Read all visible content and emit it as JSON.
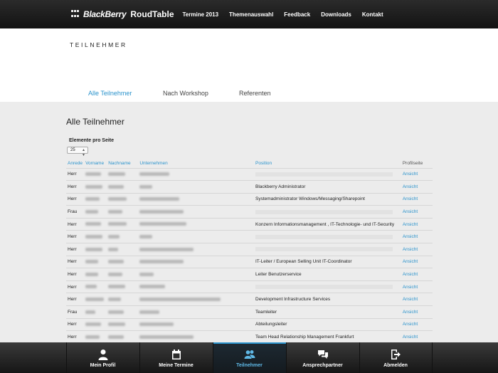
{
  "brand": {
    "name": "BlackBerry",
    "sub": "RoudTable"
  },
  "nav": [
    "Termine 2013",
    "Themenauswahl",
    "Feedback",
    "Downloads",
    "Kontakt"
  ],
  "page_title": "TEILNEHMER",
  "tabs": [
    {
      "label": "Alle Teilnehmer",
      "active": true
    },
    {
      "label": "Nach Workshop",
      "active": false
    },
    {
      "label": "Referenten",
      "active": false
    }
  ],
  "section_title": "Alle Teilnehmer",
  "per_page": {
    "label": "Elemente pro Seite",
    "value": "25"
  },
  "table": {
    "headers": [
      "Anrede",
      "Vorname",
      "Nachname",
      "Unternehmen",
      "Position",
      "Profilseite"
    ],
    "rows": [
      {
        "anrede": "Herr",
        "position": "",
        "link": "Ansicht"
      },
      {
        "anrede": "Herr",
        "position": "Blackberry Administrator",
        "link": "Ansicht"
      },
      {
        "anrede": "Herr",
        "position": "Systemadministrator Windows/Messaging/Sharepoint",
        "link": "Ansicht"
      },
      {
        "anrede": "Frau",
        "position": "",
        "link": "Ansicht"
      },
      {
        "anrede": "Herr",
        "position": "Konzern Informationsmanagement , IT-Technologie- und IT-Security",
        "link": "Ansicht"
      },
      {
        "anrede": "Herr",
        "position": "",
        "link": "Ansicht"
      },
      {
        "anrede": "Herr",
        "position": "",
        "link": "Ansicht"
      },
      {
        "anrede": "Herr",
        "position": "IT-Leiter / European Selling Unit IT-Coordinator",
        "link": "Ansicht"
      },
      {
        "anrede": "Herr",
        "position": "Leiter Benutzerservice",
        "link": "Ansicht"
      },
      {
        "anrede": "Herr",
        "position": "",
        "link": "Ansicht"
      },
      {
        "anrede": "Herr",
        "position": "Development Infrastructure Services",
        "link": "Ansicht"
      },
      {
        "anrede": "Frau",
        "position": "Teamleiter",
        "link": "Ansicht"
      },
      {
        "anrede": "Herr",
        "position": "Abteilungsleiter",
        "link": "Ansicht"
      },
      {
        "anrede": "Herr",
        "position": "Team Head Relationship Management Frankfurt",
        "link": "Ansicht"
      }
    ]
  },
  "bottom_nav": [
    {
      "label": "Mein Profil",
      "icon": "person-icon",
      "active": false
    },
    {
      "label": "Meine Termine",
      "icon": "calendar-icon",
      "active": false
    },
    {
      "label": "Teilnehmer",
      "icon": "people-icon",
      "active": true
    },
    {
      "label": "Ansprechpartner",
      "icon": "chat-icon",
      "active": false
    },
    {
      "label": "Abmelden",
      "icon": "logout-icon",
      "active": false
    }
  ],
  "colors": {
    "accent": "#2b93cc",
    "topbar": "#1a1a1a",
    "background": "#ececec"
  }
}
